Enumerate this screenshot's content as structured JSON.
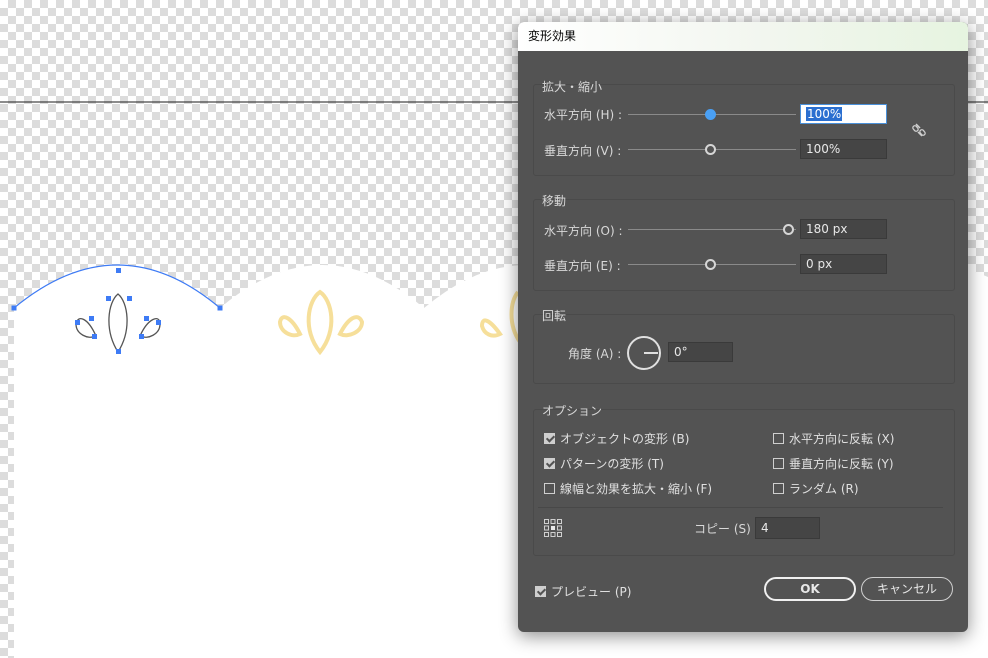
{
  "dialog": {
    "title": "変形効果",
    "scale": {
      "title": "拡大・縮小",
      "horizontal_label": "水平方向 (H) :",
      "horizontal_value": "100%",
      "vertical_label": "垂直方向 (V) :",
      "vertical_value": "100%"
    },
    "move": {
      "title": "移動",
      "horizontal_label": "水平方向 (O) :",
      "horizontal_value": "180 px",
      "vertical_label": "垂直方向 (E) :",
      "vertical_value": "0 px"
    },
    "rotate": {
      "title": "回転",
      "angle_label": "角度 (A) :",
      "angle_value": "0°"
    },
    "options": {
      "title": "オプション",
      "transform_objects": "オブジェクトの変形 (B)",
      "transform_patterns": "パターンの変形 (T)",
      "scale_strokes": "線幅と効果を拡大・縮小 (F)",
      "reflect_x": "水平方向に反転 (X)",
      "reflect_y": "垂直方向に反転 (Y)",
      "random": "ランダム (R)"
    },
    "copies_label": "コピー (S)",
    "copies_value": "4",
    "preview_label": "プレビュー (P)",
    "ok_label": "OK",
    "cancel_label": "キャンセル"
  },
  "icons": [
    "link-icon",
    "reference-point-icon",
    "angle-dial-icon"
  ],
  "colors": {
    "dialog_bg": "#535353",
    "selection_blue": "#3e7bf5",
    "motif_yellow": "#f6df9a",
    "slider_active": "#4aa0f5"
  }
}
